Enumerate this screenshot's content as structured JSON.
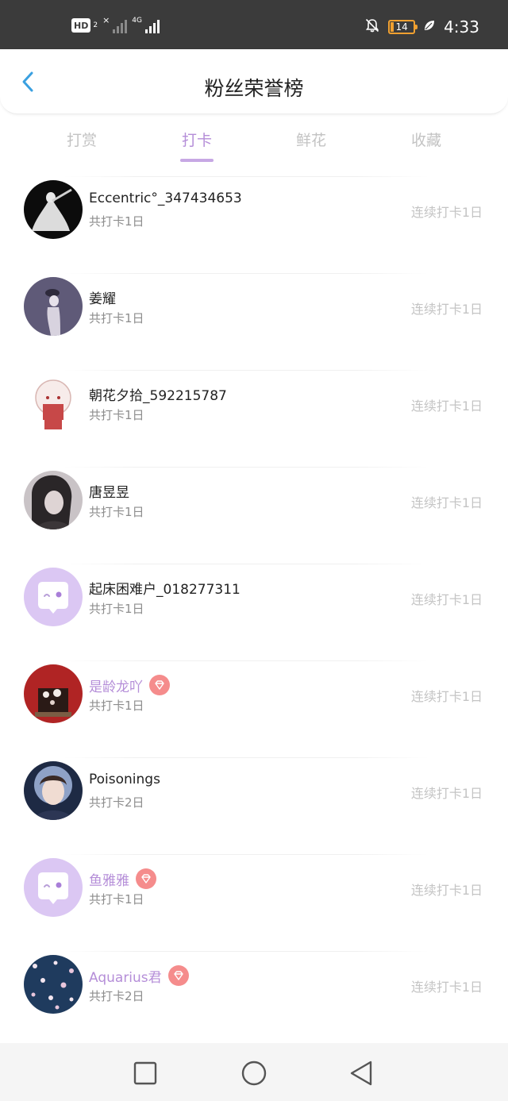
{
  "status_bar": {
    "hd_label": "HD",
    "sim_number": "2",
    "network_label": "4G",
    "x_label": "×",
    "battery_level": "14",
    "time": "4:33",
    "colors": {
      "background": "#3b3b3b",
      "battery": "#f0a030"
    },
    "icons": [
      "signal-icon",
      "mute-bell-icon",
      "battery-icon",
      "leaf-icon"
    ]
  },
  "header": {
    "title": "粉丝荣誉榜",
    "back_icon": "chevron-left-icon",
    "colors": {
      "back": "#3aa0e0"
    }
  },
  "tabs": {
    "items": [
      {
        "label": "打赏",
        "active": false
      },
      {
        "label": "打卡",
        "active": true
      },
      {
        "label": "鲜花",
        "active": false
      },
      {
        "label": "收藏",
        "active": false
      }
    ],
    "colors": {
      "active": "#b58ed8",
      "inactive": "#c3c3c3"
    }
  },
  "list": {
    "items": [
      {
        "name": "Eccentric°_347434653",
        "total": "共打卡1日",
        "streak": "连续打卡1日",
        "vip": false,
        "avatar": "dancer-avatar"
      },
      {
        "name": "姜耀",
        "total": "共打卡1日",
        "streak": "连续打卡1日",
        "vip": false,
        "avatar": "figure-avatar"
      },
      {
        "name": "朝花夕拾_592215787",
        "total": "共打卡1日",
        "streak": "连续打卡1日",
        "vip": false,
        "avatar": "cartoon-girl-avatar"
      },
      {
        "name": "唐昱昱",
        "total": "共打卡1日",
        "streak": "连续打卡1日",
        "vip": false,
        "avatar": "girl-portrait-avatar"
      },
      {
        "name": "起床困难户_018277311",
        "total": "共打卡1日",
        "streak": "连续打卡1日",
        "vip": false,
        "avatar": "default-chat-avatar"
      },
      {
        "name": "是龄龙吖",
        "total": "共打卡1日",
        "streak": "连续打卡1日",
        "vip": true,
        "avatar": "red-avatar"
      },
      {
        "name": "Poisonings",
        "total": "共打卡2日",
        "streak": "连续打卡1日",
        "vip": false,
        "avatar": "woman-portrait-avatar"
      },
      {
        "name": "鱼雅雅",
        "total": "共打卡1日",
        "streak": "连续打卡1日",
        "vip": true,
        "avatar": "default-chat-avatar"
      },
      {
        "name": "Aquarius君",
        "total": "共打卡2日",
        "streak": "连续打卡1日",
        "vip": true,
        "avatar": "floral-avatar"
      }
    ],
    "colors": {
      "vip_name": "#b58ed8",
      "gem_badge": "#f58c8c",
      "streak": "#c4c4c4"
    }
  },
  "nav_bar": {
    "buttons": [
      "recent-apps-icon",
      "home-icon",
      "back-triangle-icon"
    ]
  }
}
